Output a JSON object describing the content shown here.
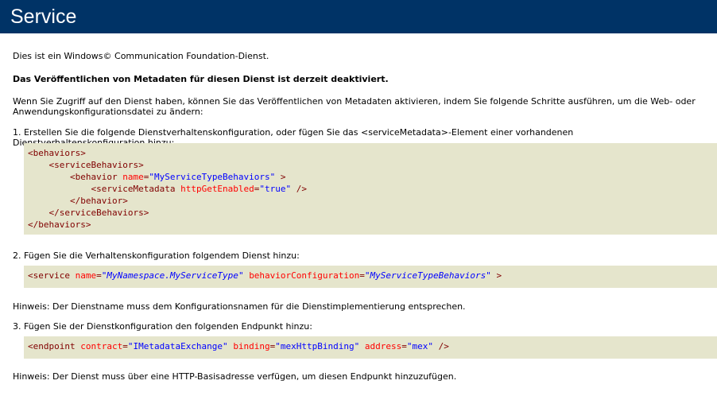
{
  "header": {
    "title": "Service"
  },
  "intro": "Dies ist ein Windows© Communication Foundation-Dienst.",
  "disabled_notice": "Das Veröffentlichen von Metadaten für diesen Dienst ist derzeit deaktiviert.",
  "access_text": "Wenn Sie Zugriff auf den Dienst haben, können Sie das Veröffentlichen von Metadaten aktivieren, indem Sie folgende Schritte ausführen, um die Web- oder Anwendungskonfigurationsdatei zu ändern:",
  "step1": {
    "text": "1. Erstellen Sie die folgende Dienstverhaltenskonfiguration, oder fügen Sie das <serviceMetadata>-Element einer vorhandenen Dienstverhaltenskonfiguration hinzu:",
    "code": {
      "behaviors_open": "<behaviors>",
      "service_behaviors_open": "<serviceBehaviors>",
      "behavior_open_tag": "<behavior",
      "name_attr": "name",
      "eq": "=",
      "name_value": "\"MyServiceTypeBehaviors\"",
      "tag_close": ">",
      "service_metadata_tag": "<serviceMetadata",
      "http_get_attr": "httpGetEnabled",
      "http_get_value": "\"true\"",
      "self_close": "/>",
      "behavior_close": "</behavior>",
      "service_behaviors_close": "</serviceBehaviors>",
      "behaviors_close": "</behaviors>"
    }
  },
  "step2": {
    "text": "2. Fügen Sie die Verhaltenskonfiguration folgendem Dienst hinzu:",
    "code": {
      "service_tag": "<service",
      "name_attr": "name",
      "q": "\"",
      "name_value": "MyNamespace.MyServiceType",
      "behavior_config_attr": "behaviorConfiguration",
      "behavior_config_value": "MyServiceTypeBehaviors",
      "tag_close": ">"
    }
  },
  "hint1": "Hinweis: Der Dienstname muss dem Konfigurationsnamen für die Dienstimplementierung entsprechen.",
  "step3": {
    "text": "3. Fügen Sie der Dienstkonfiguration den folgenden Endpunkt hinzu:",
    "code": {
      "endpoint_tag": "<endpoint",
      "contract_attr": "contract",
      "contract_value": "\"IMetadataExchange\"",
      "binding_attr": "binding",
      "binding_value": "\"mexHttpBinding\"",
      "address_attr": "address",
      "address_value": "\"mex\"",
      "self_close": "/>"
    }
  },
  "hint2": "Hinweis: Der Dienst muss über eine HTTP-Basisadresse verfügen, um diesen Endpunkt hinzuzufügen."
}
